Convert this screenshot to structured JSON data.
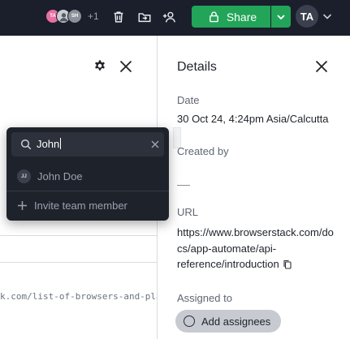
{
  "topbar": {
    "avatars": [
      "TA",
      "",
      "SH"
    ],
    "more_count": "+1",
    "share_label": "Share",
    "user_initials": "TA"
  },
  "left_panel": {
    "url_fragment": "k.com/list-of-browsers-and-platforms"
  },
  "details": {
    "title": "Details",
    "date_label": "Date",
    "date_value": "30 Oct 24, 4:24pm Asia/Calcutta",
    "created_by_label": "Created by",
    "url_label": "URL",
    "url_value": "https://www.browserstack.com/docs/app-automate/api-reference/introduction",
    "assigned_label": "Assigned to",
    "add_assignees_label": "Add assignees"
  },
  "assignee_dropdown": {
    "search_value": "John",
    "options": [
      {
        "initials": "JJ",
        "name": "John Doe"
      }
    ],
    "invite_label": "Invite team member"
  },
  "colors": {
    "topbar_bg": "#1a1f2b",
    "share_green": "#22a559",
    "dropdown_bg": "#1e222b"
  }
}
